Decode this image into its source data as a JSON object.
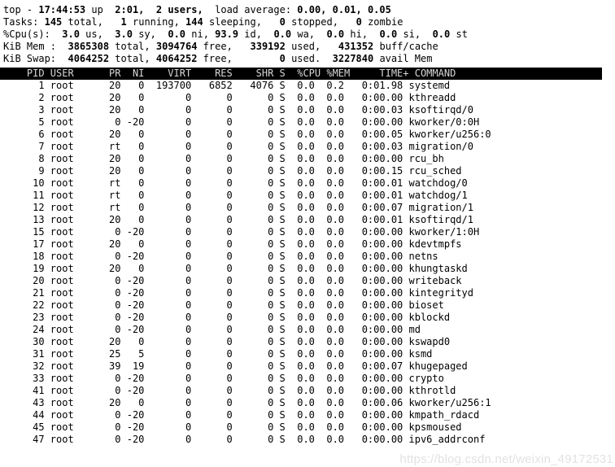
{
  "summary": {
    "line1": {
      "prefix": "top - ",
      "time": "17:44:53",
      "up_label": " up ",
      "uptime": " 2:01,",
      "users": "  2 users,",
      "load_label": "  load average: ",
      "load": "0.00, 0.01, 0.05"
    },
    "line2": {
      "label": "Tasks:",
      "total": "145",
      "total_label": " total,",
      "running": "1",
      "running_label": " running,",
      "sleeping": "144",
      "sleeping_label": " sleeping,",
      "stopped": "0",
      "stopped_label": " stopped,",
      "zombie": "0",
      "zombie_label": " zombie"
    },
    "line3": {
      "label": "%Cpu(s):",
      "us": "3.0",
      "us_label": " us,",
      "sy": "3.0",
      "sy_label": " sy,",
      "ni": "0.0",
      "ni_label": " ni,",
      "id": "93.9",
      "id_label": " id,",
      "wa": "0.0",
      "wa_label": " wa,",
      "hi": "0.0",
      "hi_label": " hi,",
      "si": "0.0",
      "si_label": " si,",
      "st": "0.0",
      "st_label": " st"
    },
    "line4": {
      "label": "KiB Mem :",
      "total": "3865308",
      "total_label": " total,",
      "free": "3094764",
      "free_label": " free,",
      "used": "339192",
      "used_label": " used,",
      "buff": "431352",
      "buff_label": " buff/cache"
    },
    "line5": {
      "label": "KiB Swap:",
      "total": "4064252",
      "total_label": " total,",
      "free": "4064252",
      "free_label": " free,",
      "used": "0",
      "used_label": " used.",
      "avail": "3227840",
      "avail_label": " avail Mem"
    }
  },
  "columns": {
    "header_text": "    PID USER      PR  NI    VIRT    RES    SHR S  %CPU %MEM     TIME+ COMMAND",
    "names": [
      "PID",
      "USER",
      "PR",
      "NI",
      "VIRT",
      "RES",
      "SHR",
      "S",
      "%CPU",
      "%MEM",
      "TIME+",
      "COMMAND"
    ]
  },
  "processes": [
    {
      "pid": "1",
      "user": "root",
      "pr": "20",
      "ni": "0",
      "virt": "193700",
      "res": "6852",
      "shr": "4076",
      "s": "S",
      "cpu": "0.0",
      "mem": "0.2",
      "time": "0:01.98",
      "command": "systemd"
    },
    {
      "pid": "2",
      "user": "root",
      "pr": "20",
      "ni": "0",
      "virt": "0",
      "res": "0",
      "shr": "0",
      "s": "S",
      "cpu": "0.0",
      "mem": "0.0",
      "time": "0:00.00",
      "command": "kthreadd"
    },
    {
      "pid": "3",
      "user": "root",
      "pr": "20",
      "ni": "0",
      "virt": "0",
      "res": "0",
      "shr": "0",
      "s": "S",
      "cpu": "0.0",
      "mem": "0.0",
      "time": "0:00.03",
      "command": "ksoftirqd/0"
    },
    {
      "pid": "5",
      "user": "root",
      "pr": "0",
      "ni": "-20",
      "virt": "0",
      "res": "0",
      "shr": "0",
      "s": "S",
      "cpu": "0.0",
      "mem": "0.0",
      "time": "0:00.00",
      "command": "kworker/0:0H"
    },
    {
      "pid": "6",
      "user": "root",
      "pr": "20",
      "ni": "0",
      "virt": "0",
      "res": "0",
      "shr": "0",
      "s": "S",
      "cpu": "0.0",
      "mem": "0.0",
      "time": "0:00.05",
      "command": "kworker/u256:0"
    },
    {
      "pid": "7",
      "user": "root",
      "pr": "rt",
      "ni": "0",
      "virt": "0",
      "res": "0",
      "shr": "0",
      "s": "S",
      "cpu": "0.0",
      "mem": "0.0",
      "time": "0:00.03",
      "command": "migration/0"
    },
    {
      "pid": "8",
      "user": "root",
      "pr": "20",
      "ni": "0",
      "virt": "0",
      "res": "0",
      "shr": "0",
      "s": "S",
      "cpu": "0.0",
      "mem": "0.0",
      "time": "0:00.00",
      "command": "rcu_bh"
    },
    {
      "pid": "9",
      "user": "root",
      "pr": "20",
      "ni": "0",
      "virt": "0",
      "res": "0",
      "shr": "0",
      "s": "S",
      "cpu": "0.0",
      "mem": "0.0",
      "time": "0:00.15",
      "command": "rcu_sched"
    },
    {
      "pid": "10",
      "user": "root",
      "pr": "rt",
      "ni": "0",
      "virt": "0",
      "res": "0",
      "shr": "0",
      "s": "S",
      "cpu": "0.0",
      "mem": "0.0",
      "time": "0:00.01",
      "command": "watchdog/0"
    },
    {
      "pid": "11",
      "user": "root",
      "pr": "rt",
      "ni": "0",
      "virt": "0",
      "res": "0",
      "shr": "0",
      "s": "S",
      "cpu": "0.0",
      "mem": "0.0",
      "time": "0:00.01",
      "command": "watchdog/1"
    },
    {
      "pid": "12",
      "user": "root",
      "pr": "rt",
      "ni": "0",
      "virt": "0",
      "res": "0",
      "shr": "0",
      "s": "S",
      "cpu": "0.0",
      "mem": "0.0",
      "time": "0:00.07",
      "command": "migration/1"
    },
    {
      "pid": "13",
      "user": "root",
      "pr": "20",
      "ni": "0",
      "virt": "0",
      "res": "0",
      "shr": "0",
      "s": "S",
      "cpu": "0.0",
      "mem": "0.0",
      "time": "0:00.01",
      "command": "ksoftirqd/1"
    },
    {
      "pid": "15",
      "user": "root",
      "pr": "0",
      "ni": "-20",
      "virt": "0",
      "res": "0",
      "shr": "0",
      "s": "S",
      "cpu": "0.0",
      "mem": "0.0",
      "time": "0:00.00",
      "command": "kworker/1:0H"
    },
    {
      "pid": "17",
      "user": "root",
      "pr": "20",
      "ni": "0",
      "virt": "0",
      "res": "0",
      "shr": "0",
      "s": "S",
      "cpu": "0.0",
      "mem": "0.0",
      "time": "0:00.00",
      "command": "kdevtmpfs"
    },
    {
      "pid": "18",
      "user": "root",
      "pr": "0",
      "ni": "-20",
      "virt": "0",
      "res": "0",
      "shr": "0",
      "s": "S",
      "cpu": "0.0",
      "mem": "0.0",
      "time": "0:00.00",
      "command": "netns"
    },
    {
      "pid": "19",
      "user": "root",
      "pr": "20",
      "ni": "0",
      "virt": "0",
      "res": "0",
      "shr": "0",
      "s": "S",
      "cpu": "0.0",
      "mem": "0.0",
      "time": "0:00.00",
      "command": "khungtaskd"
    },
    {
      "pid": "20",
      "user": "root",
      "pr": "0",
      "ni": "-20",
      "virt": "0",
      "res": "0",
      "shr": "0",
      "s": "S",
      "cpu": "0.0",
      "mem": "0.0",
      "time": "0:00.00",
      "command": "writeback"
    },
    {
      "pid": "21",
      "user": "root",
      "pr": "0",
      "ni": "-20",
      "virt": "0",
      "res": "0",
      "shr": "0",
      "s": "S",
      "cpu": "0.0",
      "mem": "0.0",
      "time": "0:00.00",
      "command": "kintegrityd"
    },
    {
      "pid": "22",
      "user": "root",
      "pr": "0",
      "ni": "-20",
      "virt": "0",
      "res": "0",
      "shr": "0",
      "s": "S",
      "cpu": "0.0",
      "mem": "0.0",
      "time": "0:00.00",
      "command": "bioset"
    },
    {
      "pid": "23",
      "user": "root",
      "pr": "0",
      "ni": "-20",
      "virt": "0",
      "res": "0",
      "shr": "0",
      "s": "S",
      "cpu": "0.0",
      "mem": "0.0",
      "time": "0:00.00",
      "command": "kblockd"
    },
    {
      "pid": "24",
      "user": "root",
      "pr": "0",
      "ni": "-20",
      "virt": "0",
      "res": "0",
      "shr": "0",
      "s": "S",
      "cpu": "0.0",
      "mem": "0.0",
      "time": "0:00.00",
      "command": "md"
    },
    {
      "pid": "30",
      "user": "root",
      "pr": "20",
      "ni": "0",
      "virt": "0",
      "res": "0",
      "shr": "0",
      "s": "S",
      "cpu": "0.0",
      "mem": "0.0",
      "time": "0:00.00",
      "command": "kswapd0"
    },
    {
      "pid": "31",
      "user": "root",
      "pr": "25",
      "ni": "5",
      "virt": "0",
      "res": "0",
      "shr": "0",
      "s": "S",
      "cpu": "0.0",
      "mem": "0.0",
      "time": "0:00.00",
      "command": "ksmd"
    },
    {
      "pid": "32",
      "user": "root",
      "pr": "39",
      "ni": "19",
      "virt": "0",
      "res": "0",
      "shr": "0",
      "s": "S",
      "cpu": "0.0",
      "mem": "0.0",
      "time": "0:00.07",
      "command": "khugepaged"
    },
    {
      "pid": "33",
      "user": "root",
      "pr": "0",
      "ni": "-20",
      "virt": "0",
      "res": "0",
      "shr": "0",
      "s": "S",
      "cpu": "0.0",
      "mem": "0.0",
      "time": "0:00.00",
      "command": "crypto"
    },
    {
      "pid": "41",
      "user": "root",
      "pr": "0",
      "ni": "-20",
      "virt": "0",
      "res": "0",
      "shr": "0",
      "s": "S",
      "cpu": "0.0",
      "mem": "0.0",
      "time": "0:00.00",
      "command": "kthrotld"
    },
    {
      "pid": "43",
      "user": "root",
      "pr": "20",
      "ni": "0",
      "virt": "0",
      "res": "0",
      "shr": "0",
      "s": "S",
      "cpu": "0.0",
      "mem": "0.0",
      "time": "0:00.06",
      "command": "kworker/u256:1"
    },
    {
      "pid": "44",
      "user": "root",
      "pr": "0",
      "ni": "-20",
      "virt": "0",
      "res": "0",
      "shr": "0",
      "s": "S",
      "cpu": "0.0",
      "mem": "0.0",
      "time": "0:00.00",
      "command": "kmpath_rdacd"
    },
    {
      "pid": "45",
      "user": "root",
      "pr": "0",
      "ni": "-20",
      "virt": "0",
      "res": "0",
      "shr": "0",
      "s": "S",
      "cpu": "0.0",
      "mem": "0.0",
      "time": "0:00.00",
      "command": "kpsmoused"
    },
    {
      "pid": "47",
      "user": "root",
      "pr": "0",
      "ni": "-20",
      "virt": "0",
      "res": "0",
      "shr": "0",
      "s": "S",
      "cpu": "0.0",
      "mem": "0.0",
      "time": "0:00.00",
      "command": "ipv6_addrconf"
    }
  ],
  "watermark": {
    "text": "https://blog.csdn.net/weixin_49172531"
  },
  "colors": {
    "background": "#ffffff",
    "foreground": "#000000",
    "header_bar_bg": "#000000",
    "header_bar_fg": "#d8d8d8",
    "watermark": "#e2e2e2"
  }
}
